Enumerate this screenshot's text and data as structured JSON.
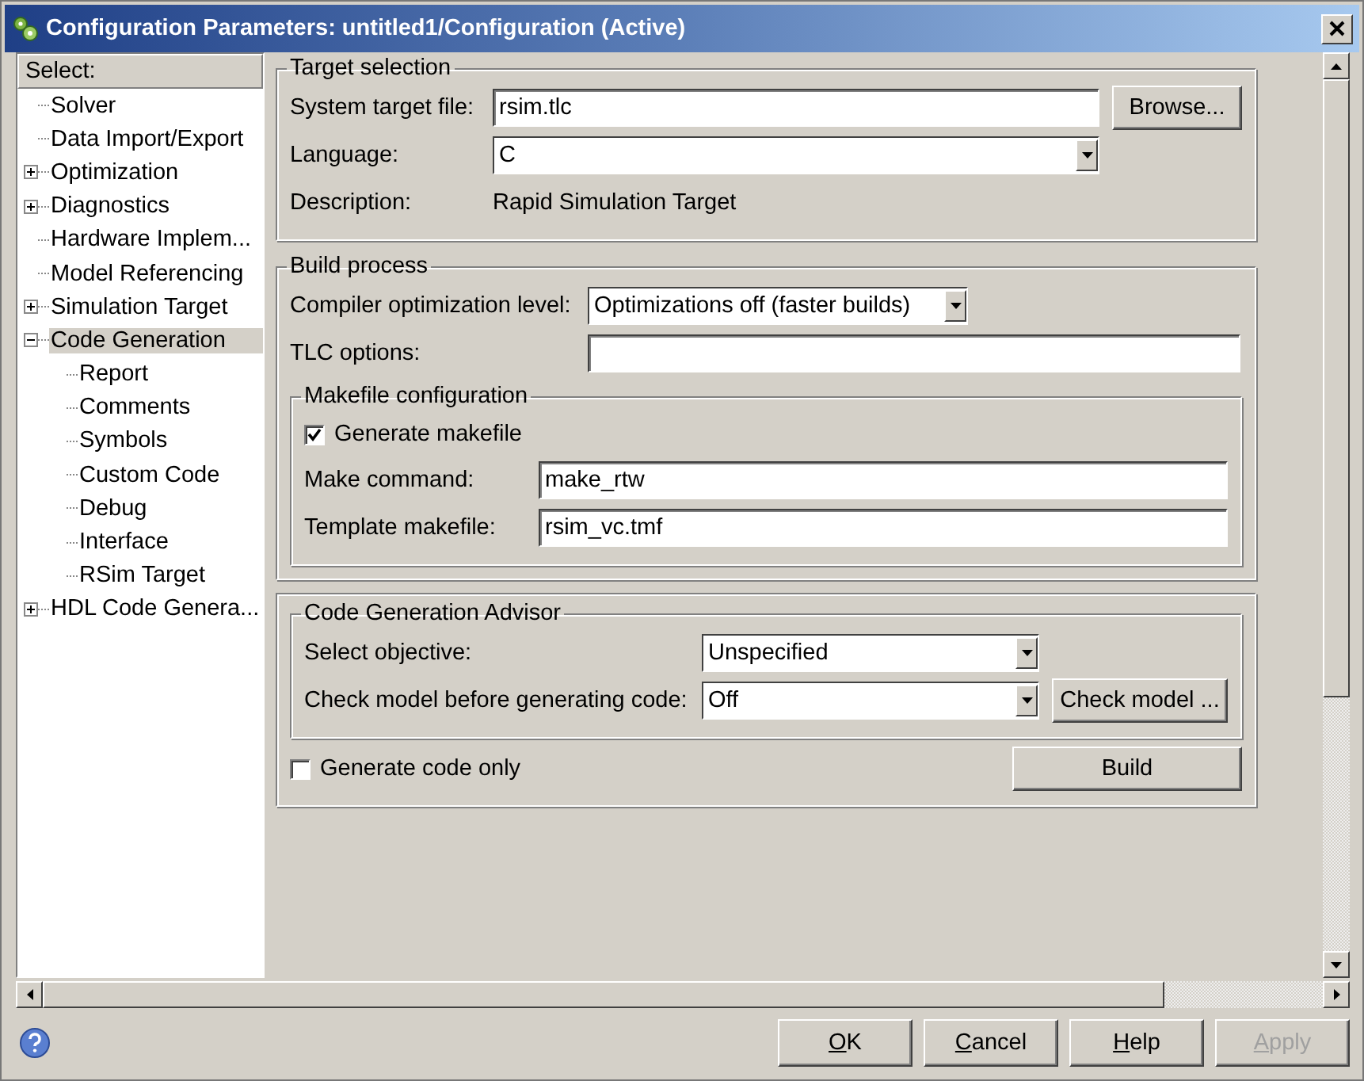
{
  "window": {
    "title": "Configuration Parameters: untitled1/Configuration (Active)"
  },
  "tree": {
    "header": "Select:",
    "items": [
      {
        "label": "Solver",
        "selected": false
      },
      {
        "label": "Data Import/Export",
        "selected": false
      },
      {
        "label": "Optimization",
        "selected": false,
        "expanded": false
      },
      {
        "label": "Diagnostics",
        "selected": false,
        "expanded": false
      },
      {
        "label": "Hardware Implem...",
        "selected": false
      },
      {
        "label": "Model Referencing",
        "selected": false
      },
      {
        "label": "Simulation Target",
        "selected": false,
        "expanded": false
      },
      {
        "label": "Code Generation",
        "selected": true,
        "expanded": true,
        "children": [
          {
            "label": "Report",
            "selected": false
          },
          {
            "label": "Comments",
            "selected": false
          },
          {
            "label": "Symbols",
            "selected": false
          },
          {
            "label": "Custom Code",
            "selected": false
          },
          {
            "label": "Debug",
            "selected": false
          },
          {
            "label": "Interface",
            "selected": false
          },
          {
            "label": "RSim Target",
            "selected": false
          }
        ]
      },
      {
        "label": "HDL Code Genera...",
        "selected": false,
        "expanded": false
      }
    ]
  },
  "target_selection": {
    "title": "Target selection",
    "system_target_label": "System target file:",
    "system_target_value": "rsim.tlc",
    "browse_button": "Browse...",
    "language_label": "Language:",
    "language_value": "C",
    "description_label": "Description:",
    "description_value": "Rapid Simulation Target"
  },
  "build_process": {
    "title": "Build process",
    "compiler_label": "Compiler optimization level:",
    "compiler_value": "Optimizations off (faster builds)",
    "tlc_label": "TLC options:",
    "makefile": {
      "title": "Makefile configuration",
      "generate_label": "Generate makefile",
      "generate_checked": true,
      "make_command_label": "Make command:",
      "make_command_value": "make_rtw",
      "template_label": "Template makefile:",
      "template_value": "rsim_vc.tmf"
    }
  },
  "advisor": {
    "title": "Code Generation Advisor",
    "objective_label": "Select objective:",
    "objective_value": "Unspecified",
    "check_label": "Check model before generating code:",
    "check_value": "Off",
    "check_button": "Check model ...",
    "generate_code_only_label": "Generate code only",
    "generate_code_only_checked": false,
    "build_button": "Build"
  },
  "buttons": [
    {
      "label": "OK",
      "disabled": false
    },
    {
      "label": "Cancel",
      "disabled": false
    },
    {
      "label": "Help",
      "disabled": false
    },
    {
      "label": "Apply",
      "disabled": true
    }
  ]
}
